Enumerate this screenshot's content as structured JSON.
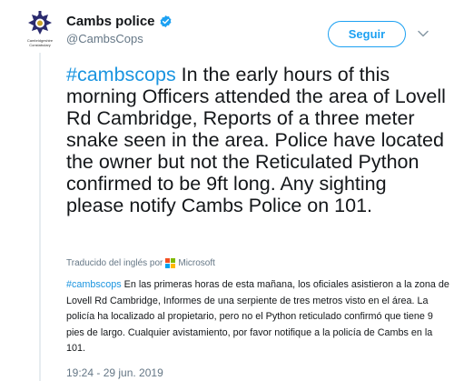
{
  "tweet": {
    "author": {
      "display_name": "Cambs police",
      "handle": "@CambsCops",
      "verified_icon": "verified-badge-icon",
      "avatar_caption_line1": "Cambridgeshire",
      "avatar_caption_line2": "Constabulary"
    },
    "follow_label": "Seguir",
    "hashtag": "#cambscops",
    "body": " In the early hours of this morning Officers attended the area of Lovell Rd Cambridge, Reports of a three meter snake seen in the area. Police have located the owner but not the Reticulated Python confirmed to be 9ft long. Any sighting please notify Cambs Police on 101.",
    "translated_by_label": "Traducido del inglés por",
    "translator_name": "Microsoft",
    "translation_hashtag": "#cambscops",
    "translation_body": " En las primeras horas de esta mañana, los oficiales asistieron a la zona de Lovell Rd Cambridge, Informes de una serpiente de tres metros visto en el área. La policía ha localizado al propietario, pero no el Python reticulado confirmó que tiene 9 pies de largo. Cualquier avistamiento, por favor notifique a la policía de Cambs en la 101.",
    "timestamp": "19:24 - 29 jun. 2019"
  },
  "colors": {
    "accent": "#1da1f2",
    "hashtag": "#1b95e0",
    "secondary_text": "#657786",
    "ms_red": "#f25022",
    "ms_green": "#7fba00",
    "ms_blue": "#00a4ef",
    "ms_yellow": "#ffb900"
  }
}
